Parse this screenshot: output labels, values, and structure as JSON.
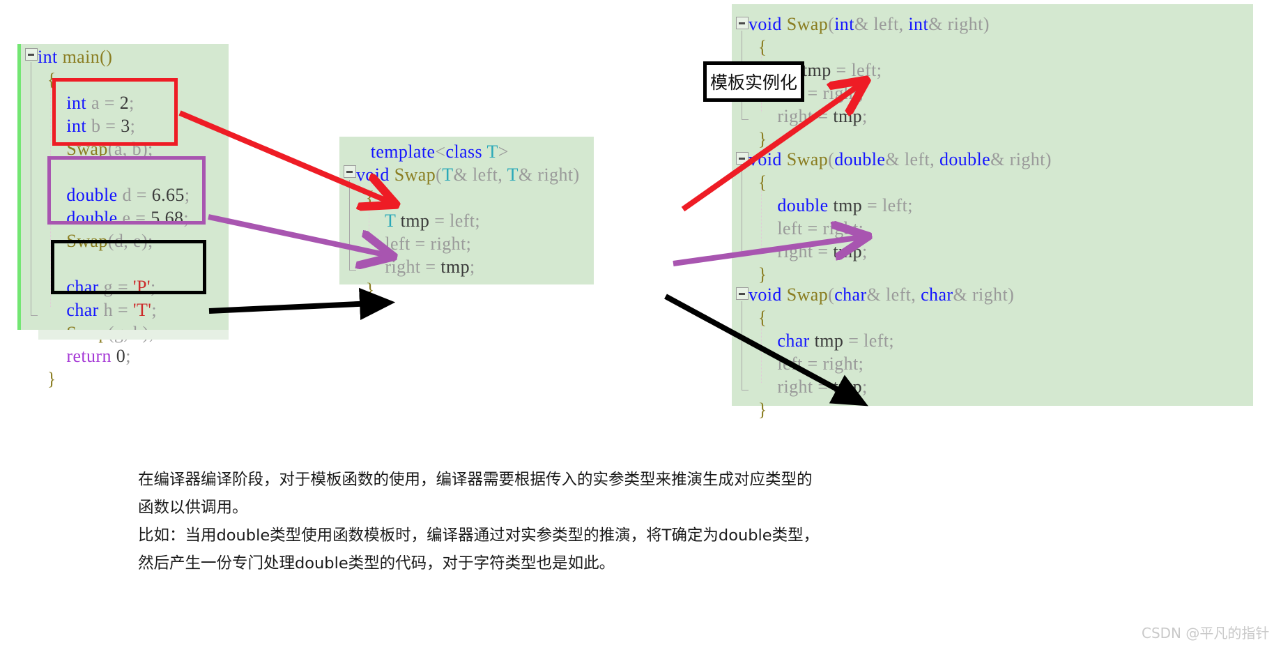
{
  "left_panel": {
    "name": "main-function-code",
    "lines": [
      [
        {
          "t": "int ",
          "c": "kw"
        },
        {
          "t": "main",
          "c": "fn"
        },
        {
          "t": "()",
          "c": "brace"
        }
      ],
      [
        {
          "t": "  {",
          "c": "brace"
        }
      ],
      [
        {
          "t": "      int ",
          "c": "kw"
        },
        {
          "t": "a = ",
          "c": "plain"
        },
        {
          "t": "2",
          "c": "dark"
        },
        {
          "t": ";",
          "c": "plain"
        }
      ],
      [
        {
          "t": "      int ",
          "c": "kw"
        },
        {
          "t": "b = ",
          "c": "plain"
        },
        {
          "t": "3",
          "c": "dark"
        },
        {
          "t": ";",
          "c": "plain"
        }
      ],
      [
        {
          "t": "      Swap",
          "c": "fn"
        },
        {
          "t": "(a, b);",
          "c": "plain"
        }
      ],
      [
        {
          "t": "",
          "c": "plain"
        }
      ],
      [
        {
          "t": "      double ",
          "c": "kw"
        },
        {
          "t": "d = ",
          "c": "plain"
        },
        {
          "t": "6.65",
          "c": "dark"
        },
        {
          "t": ";",
          "c": "plain"
        }
      ],
      [
        {
          "t": "      double ",
          "c": "kw"
        },
        {
          "t": "e = ",
          "c": "plain"
        },
        {
          "t": "5.68",
          "c": "dark"
        },
        {
          "t": ";",
          "c": "plain"
        }
      ],
      [
        {
          "t": "      Swap",
          "c": "fn"
        },
        {
          "t": "(d, e);",
          "c": "plain"
        }
      ],
      [
        {
          "t": "",
          "c": "plain"
        }
      ],
      [
        {
          "t": "      char ",
          "c": "kw"
        },
        {
          "t": "g = ",
          "c": "plain"
        },
        {
          "t": "'P'",
          "c": "chr"
        },
        {
          "t": ";",
          "c": "plain"
        }
      ],
      [
        {
          "t": "      char ",
          "c": "kw"
        },
        {
          "t": "h = ",
          "c": "plain"
        },
        {
          "t": "'T'",
          "c": "chr"
        },
        {
          "t": ";",
          "c": "plain"
        }
      ],
      [
        {
          "t": "      Swap",
          "c": "fn"
        },
        {
          "t": "(g, h);",
          "c": "plain"
        }
      ],
      [
        {
          "t": "      return ",
          "c": "ret"
        },
        {
          "t": "0",
          "c": "dark"
        },
        {
          "t": ";",
          "c": "plain"
        }
      ],
      [
        {
          "t": "  }",
          "c": "brace"
        }
      ]
    ]
  },
  "center_panel": {
    "name": "template-swap-code",
    "lines": [
      [
        {
          "t": "   template",
          "c": "kw"
        },
        {
          "t": "<",
          "c": "plain"
        },
        {
          "t": "class ",
          "c": "kw"
        },
        {
          "t": "T",
          "c": "tparam"
        },
        {
          "t": ">",
          "c": "plain"
        }
      ],
      [
        {
          "t": "void ",
          "c": "kw"
        },
        {
          "t": "Swap",
          "c": "fn"
        },
        {
          "t": "(",
          "c": "plain"
        },
        {
          "t": "T",
          "c": "tparam"
        },
        {
          "t": "& left, ",
          "c": "plain"
        },
        {
          "t": "T",
          "c": "tparam"
        },
        {
          "t": "& right)",
          "c": "plain"
        }
      ],
      [
        {
          "t": "  {",
          "c": "brace"
        }
      ],
      [
        {
          "t": "      ",
          "c": "plain"
        },
        {
          "t": "T",
          "c": "tparam"
        },
        {
          "t": " ",
          "c": "plain"
        },
        {
          "t": "tmp",
          "c": "dark"
        },
        {
          "t": " = left;",
          "c": "plain"
        }
      ],
      [
        {
          "t": "      left = right;",
          "c": "plain"
        }
      ],
      [
        {
          "t": "      right = ",
          "c": "plain"
        },
        {
          "t": "tmp",
          "c": "dark"
        },
        {
          "t": ";",
          "c": "plain"
        }
      ],
      [
        {
          "t": "  }",
          "c": "brace"
        }
      ]
    ]
  },
  "right_panel": {
    "name": "instantiated-swap-functions",
    "blocks": [
      {
        "name": "swap-int",
        "lines": [
          [
            {
              "t": "void ",
              "c": "kw"
            },
            {
              "t": "Swap",
              "c": "fn"
            },
            {
              "t": "(",
              "c": "plain"
            },
            {
              "t": "int",
              "c": "kw"
            },
            {
              "t": "& left, ",
              "c": "plain"
            },
            {
              "t": "int",
              "c": "kw"
            },
            {
              "t": "& right)",
              "c": "plain"
            }
          ],
          [
            {
              "t": "  {",
              "c": "brace"
            }
          ],
          [
            {
              "t": "      int ",
              "c": "kw"
            },
            {
              "t": "tmp",
              "c": "dark"
            },
            {
              "t": " = left;",
              "c": "plain"
            }
          ],
          [
            {
              "t": "      left = right;",
              "c": "plain"
            }
          ],
          [
            {
              "t": "      right = ",
              "c": "plain"
            },
            {
              "t": "tmp",
              "c": "dark"
            },
            {
              "t": ";",
              "c": "plain"
            }
          ],
          [
            {
              "t": "  }",
              "c": "brace"
            }
          ]
        ]
      },
      {
        "name": "swap-double",
        "lines": [
          [
            {
              "t": "void ",
              "c": "kw"
            },
            {
              "t": "Swap",
              "c": "fn"
            },
            {
              "t": "(",
              "c": "plain"
            },
            {
              "t": "double",
              "c": "kw"
            },
            {
              "t": "& left, ",
              "c": "plain"
            },
            {
              "t": "double",
              "c": "kw"
            },
            {
              "t": "& right)",
              "c": "plain"
            }
          ],
          [
            {
              "t": "  {",
              "c": "brace"
            }
          ],
          [
            {
              "t": "      double ",
              "c": "kw"
            },
            {
              "t": "tmp",
              "c": "dark"
            },
            {
              "t": " = left;",
              "c": "plain"
            }
          ],
          [
            {
              "t": "      left = right;",
              "c": "plain"
            }
          ],
          [
            {
              "t": "      right = ",
              "c": "plain"
            },
            {
              "t": "tmp",
              "c": "dark"
            },
            {
              "t": ";",
              "c": "plain"
            }
          ],
          [
            {
              "t": "  }",
              "c": "brace"
            }
          ]
        ]
      },
      {
        "name": "swap-char",
        "lines": [
          [
            {
              "t": "void ",
              "c": "kw"
            },
            {
              "t": "Swap",
              "c": "fn"
            },
            {
              "t": "(",
              "c": "plain"
            },
            {
              "t": "char",
              "c": "kw"
            },
            {
              "t": "& left, ",
              "c": "plain"
            },
            {
              "t": "char",
              "c": "kw"
            },
            {
              "t": "& right)",
              "c": "plain"
            }
          ],
          [
            {
              "t": "  {",
              "c": "brace"
            }
          ],
          [
            {
              "t": "      char ",
              "c": "kw"
            },
            {
              "t": "tmp",
              "c": "dark"
            },
            {
              "t": " = left;",
              "c": "plain"
            }
          ],
          [
            {
              "t": "      left = right;",
              "c": "plain"
            }
          ],
          [
            {
              "t": "      right = ",
              "c": "plain"
            },
            {
              "t": "tmp",
              "c": "dark"
            },
            {
              "t": ";",
              "c": "plain"
            }
          ],
          [
            {
              "t": "  }",
              "c": "brace"
            }
          ]
        ]
      }
    ]
  },
  "label_box": {
    "text": "模板实例化"
  },
  "prose": {
    "paragraph1": "在编译器编译阶段，对于模板函数的使用，编译器需要根据传入的实参类型来推演生成对应类型的函数以供调用。",
    "paragraph2": "比如：当用double类型使用函数模板时，编译器通过对实参类型的推演，将T确定为double类型，然后产生一份专门处理double类型的代码，对于字符类型也是如此。"
  },
  "watermark": {
    "text": "CSDN @平凡的指针"
  },
  "colors": {
    "panel_bg": "#d4e8d0",
    "green_bar": "#73e673",
    "arrow_red": "#ee1c25",
    "arrow_purple": "#a855b0",
    "arrow_black": "#000000",
    "keyword": "#1414ff",
    "function": "#8a7d21",
    "template_param": "#2aa8b8",
    "return_kw": "#a63ad6",
    "char_literal": "#cc2a2a",
    "plain_text": "#9a9a9a"
  }
}
